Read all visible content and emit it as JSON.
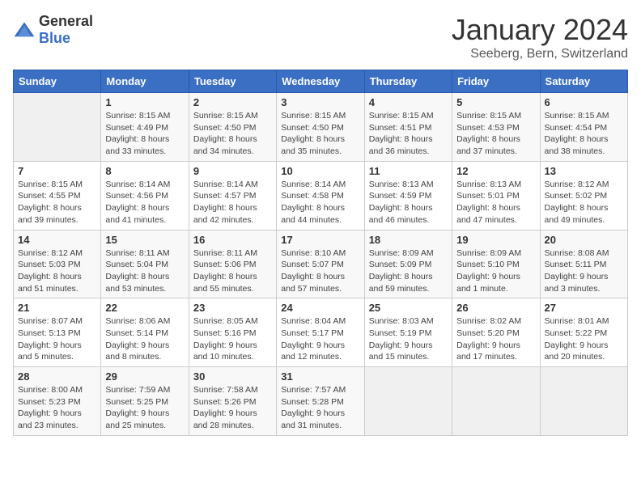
{
  "logo": {
    "general": "General",
    "blue": "Blue"
  },
  "header": {
    "title": "January 2024",
    "subtitle": "Seeberg, Bern, Switzerland"
  },
  "weekdays": [
    "Sunday",
    "Monday",
    "Tuesday",
    "Wednesday",
    "Thursday",
    "Friday",
    "Saturday"
  ],
  "weeks": [
    [
      {
        "day": "",
        "empty": true
      },
      {
        "day": "1",
        "sunrise": "8:15 AM",
        "sunset": "4:49 PM",
        "daylight": "8 hours and 33 minutes."
      },
      {
        "day": "2",
        "sunrise": "8:15 AM",
        "sunset": "4:50 PM",
        "daylight": "8 hours and 34 minutes."
      },
      {
        "day": "3",
        "sunrise": "8:15 AM",
        "sunset": "4:50 PM",
        "daylight": "8 hours and 35 minutes."
      },
      {
        "day": "4",
        "sunrise": "8:15 AM",
        "sunset": "4:51 PM",
        "daylight": "8 hours and 36 minutes."
      },
      {
        "day": "5",
        "sunrise": "8:15 AM",
        "sunset": "4:53 PM",
        "daylight": "8 hours and 37 minutes."
      },
      {
        "day": "6",
        "sunrise": "8:15 AM",
        "sunset": "4:54 PM",
        "daylight": "8 hours and 38 minutes."
      }
    ],
    [
      {
        "day": "7",
        "sunrise": "8:15 AM",
        "sunset": "4:55 PM",
        "daylight": "8 hours and 39 minutes."
      },
      {
        "day": "8",
        "sunrise": "8:14 AM",
        "sunset": "4:56 PM",
        "daylight": "8 hours and 41 minutes."
      },
      {
        "day": "9",
        "sunrise": "8:14 AM",
        "sunset": "4:57 PM",
        "daylight": "8 hours and 42 minutes."
      },
      {
        "day": "10",
        "sunrise": "8:14 AM",
        "sunset": "4:58 PM",
        "daylight": "8 hours and 44 minutes."
      },
      {
        "day": "11",
        "sunrise": "8:13 AM",
        "sunset": "4:59 PM",
        "daylight": "8 hours and 46 minutes."
      },
      {
        "day": "12",
        "sunrise": "8:13 AM",
        "sunset": "5:01 PM",
        "daylight": "8 hours and 47 minutes."
      },
      {
        "day": "13",
        "sunrise": "8:12 AM",
        "sunset": "5:02 PM",
        "daylight": "8 hours and 49 minutes."
      }
    ],
    [
      {
        "day": "14",
        "sunrise": "8:12 AM",
        "sunset": "5:03 PM",
        "daylight": "8 hours and 51 minutes."
      },
      {
        "day": "15",
        "sunrise": "8:11 AM",
        "sunset": "5:04 PM",
        "daylight": "8 hours and 53 minutes."
      },
      {
        "day": "16",
        "sunrise": "8:11 AM",
        "sunset": "5:06 PM",
        "daylight": "8 hours and 55 minutes."
      },
      {
        "day": "17",
        "sunrise": "8:10 AM",
        "sunset": "5:07 PM",
        "daylight": "8 hours and 57 minutes."
      },
      {
        "day": "18",
        "sunrise": "8:09 AM",
        "sunset": "5:09 PM",
        "daylight": "8 hours and 59 minutes."
      },
      {
        "day": "19",
        "sunrise": "8:09 AM",
        "sunset": "5:10 PM",
        "daylight": "9 hours and 1 minute."
      },
      {
        "day": "20",
        "sunrise": "8:08 AM",
        "sunset": "5:11 PM",
        "daylight": "9 hours and 3 minutes."
      }
    ],
    [
      {
        "day": "21",
        "sunrise": "8:07 AM",
        "sunset": "5:13 PM",
        "daylight": "9 hours and 5 minutes."
      },
      {
        "day": "22",
        "sunrise": "8:06 AM",
        "sunset": "5:14 PM",
        "daylight": "9 hours and 8 minutes."
      },
      {
        "day": "23",
        "sunrise": "8:05 AM",
        "sunset": "5:16 PM",
        "daylight": "9 hours and 10 minutes."
      },
      {
        "day": "24",
        "sunrise": "8:04 AM",
        "sunset": "5:17 PM",
        "daylight": "9 hours and 12 minutes."
      },
      {
        "day": "25",
        "sunrise": "8:03 AM",
        "sunset": "5:19 PM",
        "daylight": "9 hours and 15 minutes."
      },
      {
        "day": "26",
        "sunrise": "8:02 AM",
        "sunset": "5:20 PM",
        "daylight": "9 hours and 17 minutes."
      },
      {
        "day": "27",
        "sunrise": "8:01 AM",
        "sunset": "5:22 PM",
        "daylight": "9 hours and 20 minutes."
      }
    ],
    [
      {
        "day": "28",
        "sunrise": "8:00 AM",
        "sunset": "5:23 PM",
        "daylight": "9 hours and 23 minutes."
      },
      {
        "day": "29",
        "sunrise": "7:59 AM",
        "sunset": "5:25 PM",
        "daylight": "9 hours and 25 minutes."
      },
      {
        "day": "30",
        "sunrise": "7:58 AM",
        "sunset": "5:26 PM",
        "daylight": "9 hours and 28 minutes."
      },
      {
        "day": "31",
        "sunrise": "7:57 AM",
        "sunset": "5:28 PM",
        "daylight": "9 hours and 31 minutes."
      },
      {
        "day": "",
        "empty": true
      },
      {
        "day": "",
        "empty": true
      },
      {
        "day": "",
        "empty": true
      }
    ]
  ],
  "labels": {
    "sunrise": "Sunrise:",
    "sunset": "Sunset:",
    "daylight": "Daylight:"
  }
}
